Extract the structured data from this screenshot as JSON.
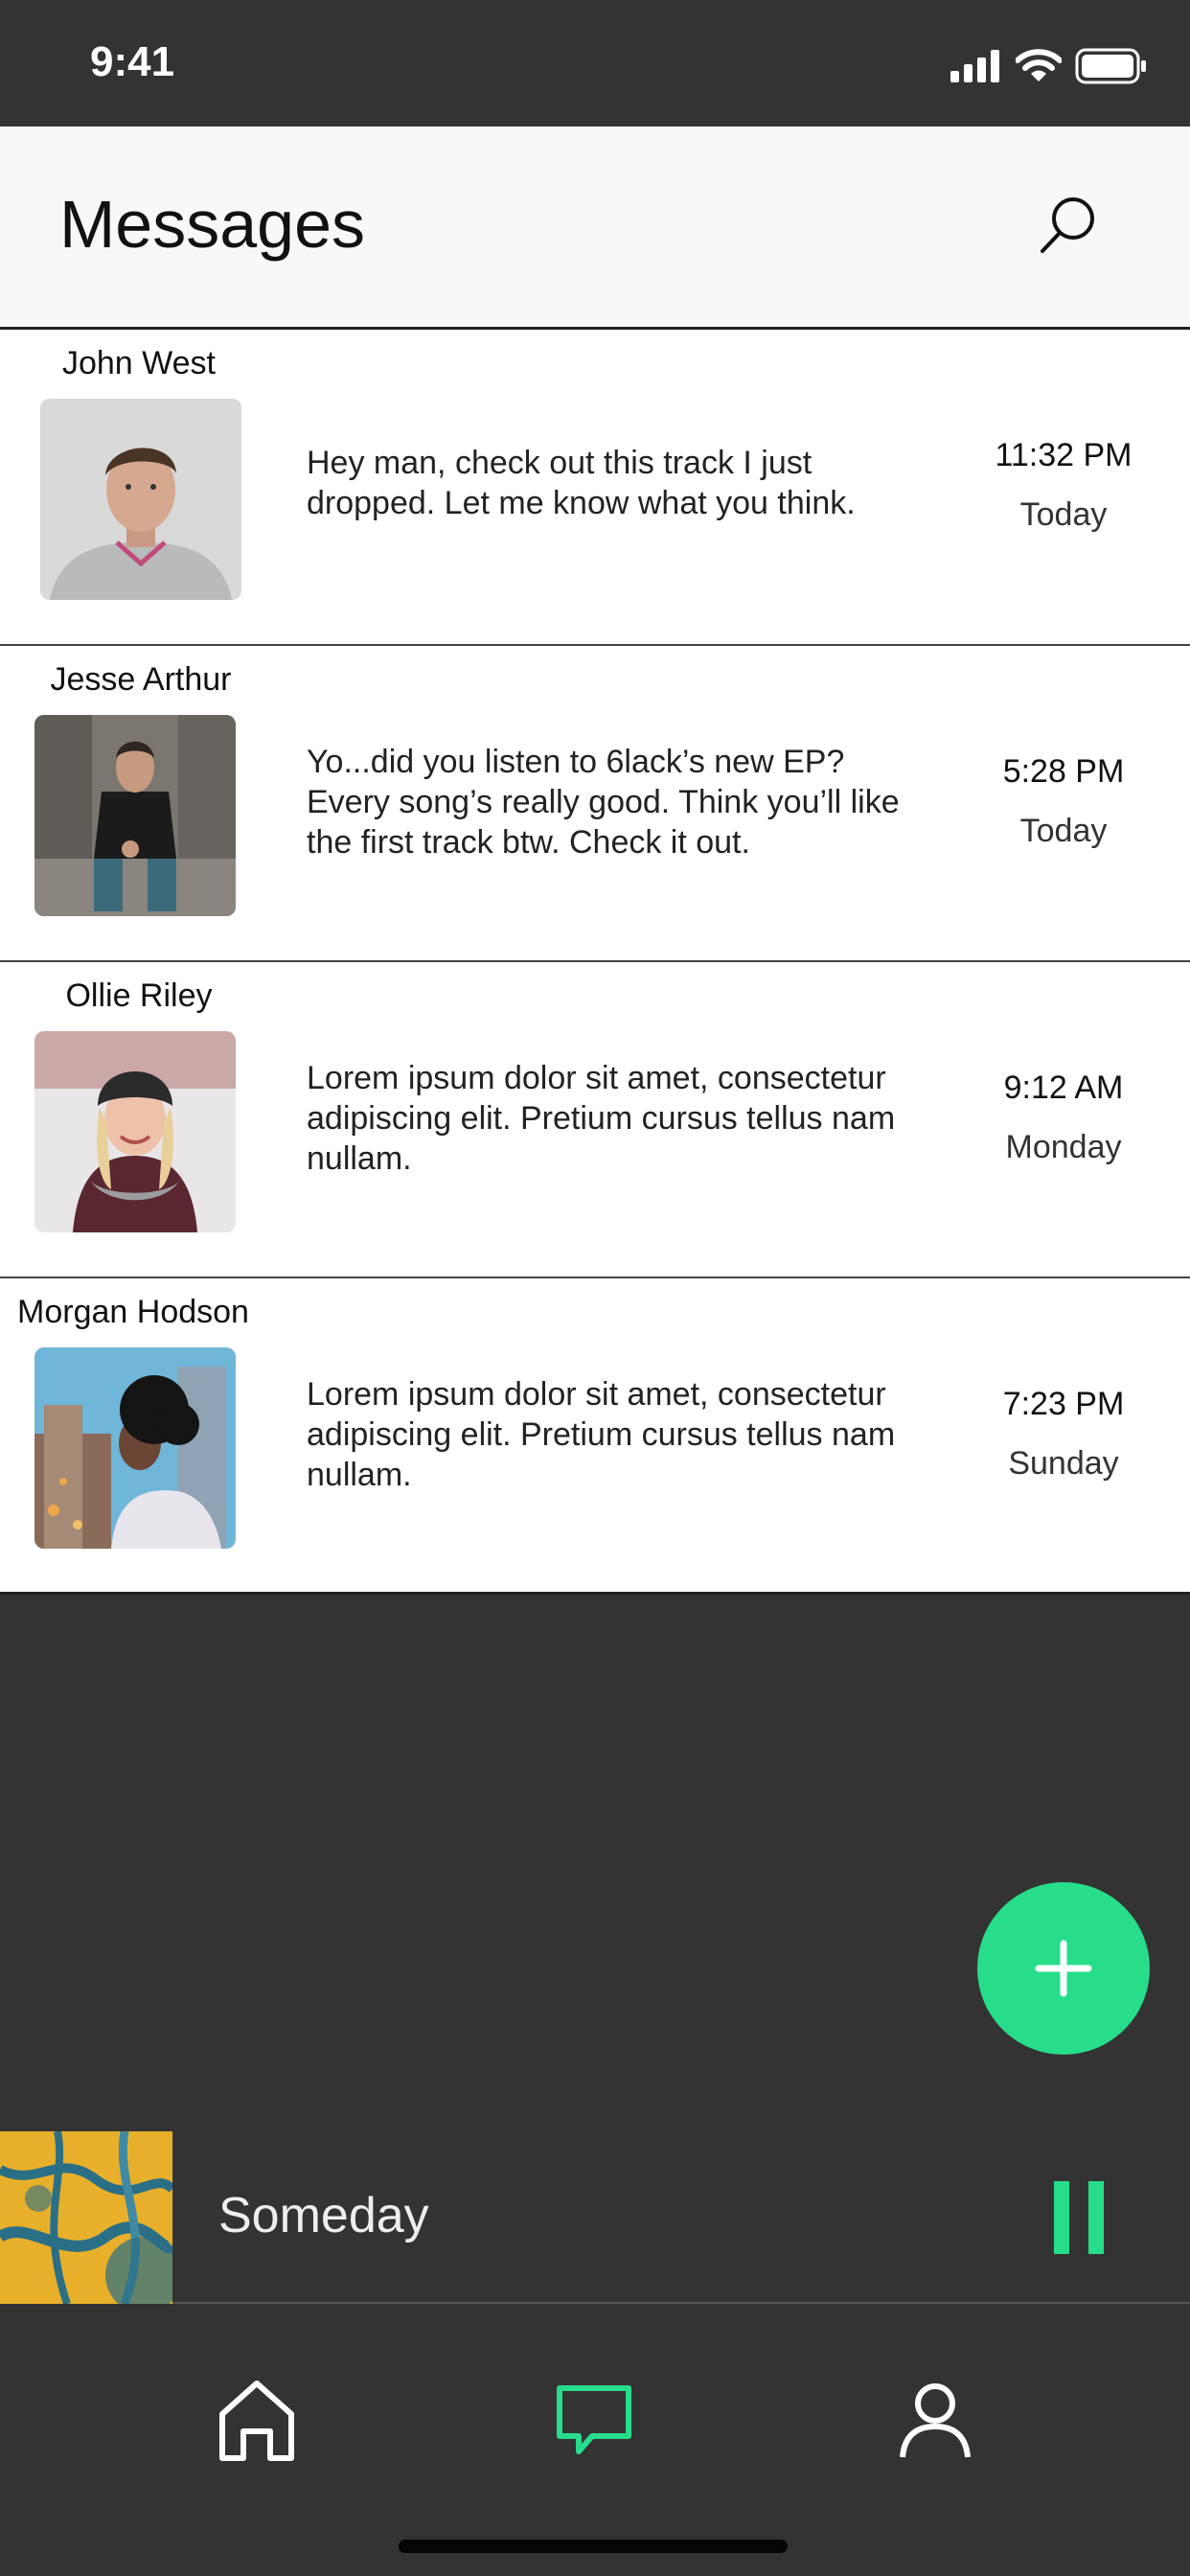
{
  "status_bar": {
    "time": "9:41"
  },
  "header": {
    "title": "Messages",
    "search_icon": "search-icon"
  },
  "messages": [
    {
      "sender": "John West",
      "preview": "Hey man, check out this track I just dropped. Let me know what you think.",
      "time": "11:32 PM",
      "day": "Today"
    },
    {
      "sender": "Jesse Arthur",
      "preview": "Yo...did you listen to 6lack’s new EP? Every song’s really good. Think you’ll like the first track btw. Check it out.",
      "time": "5:28 PM",
      "day": "Today"
    },
    {
      "sender": "Ollie Riley",
      "preview": "Lorem ipsum dolor sit amet, consectetur adipiscing elit. Pretium cursus tellus nam nullam.",
      "time": "9:12 AM",
      "day": "Monday"
    },
    {
      "sender": "Morgan Hodson",
      "preview": "Lorem ipsum dolor sit amet, consectetur adipiscing elit. Pretium cursus tellus nam nullam.",
      "time": "7:23 PM",
      "day": "Sunday"
    }
  ],
  "fab": {
    "icon": "plus-icon",
    "color": "#27dd8a"
  },
  "now_playing": {
    "title": "Someday",
    "state_icon": "pause-icon"
  },
  "bottom_nav": [
    {
      "icon": "home-icon",
      "active": false
    },
    {
      "icon": "chat-icon",
      "active": true
    },
    {
      "icon": "profile-icon",
      "active": false
    }
  ],
  "colors": {
    "accent": "#27dd8a",
    "dark_bg": "#333333",
    "header_bg": "#f8f8f8"
  }
}
